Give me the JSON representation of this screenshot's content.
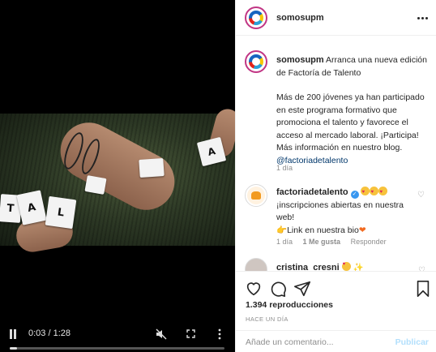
{
  "video": {
    "letters": [
      "T",
      "A",
      "L",
      "A"
    ],
    "time": "0:03 / 1:28",
    "progress_fraction": 0.035
  },
  "header": {
    "username": "somosupm"
  },
  "caption": {
    "username": "somosupm",
    "line1": "Arranca una nueva edición de Factoría de Talento",
    "line2": "Más de 200 jóvenes ya han participado en este programa formativo que promociona el talento y favorece el acceso al mercado laboral. ¡Participa! Más información en nuestro blog.",
    "mention": "@factoriadetalento",
    "age": "1 día"
  },
  "comments": [
    {
      "username": "factoriadetalento",
      "text_line1": "¡inscripciones abiertas en nuestra web!",
      "text_line2": "Link en nuestra bio",
      "age": "1 día",
      "likes": "1 Me gusta",
      "reply": "Responder"
    },
    {
      "username": "cristina_cresni"
    }
  ],
  "stats": {
    "views": "1.394 reproducciones",
    "posted": "HACE UN DÍA"
  },
  "composer": {
    "placeholder": "Añade un comentario...",
    "publish": "Publicar"
  },
  "icons": [
    "more-icon",
    "heart-icon",
    "comment-icon",
    "share-icon",
    "bookmark-icon",
    "pause-icon",
    "mute-icon",
    "fullscreen-icon",
    "verified-icon"
  ]
}
